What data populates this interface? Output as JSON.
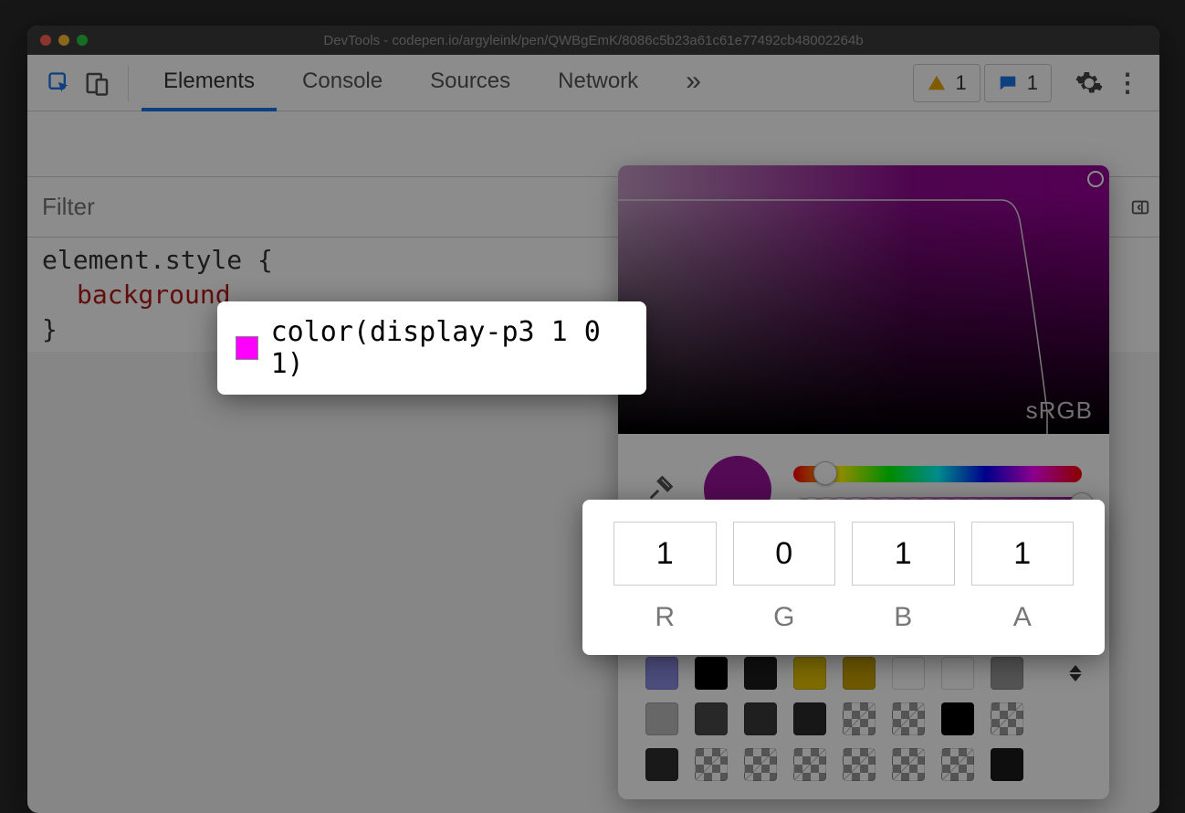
{
  "window": {
    "title": "DevTools - codepen.io/argyleink/pen/QWBgEmK/8086c5b23a61c61e77492cb48002264b"
  },
  "tabs": {
    "items": [
      "Elements",
      "Console",
      "Sources",
      "Network"
    ],
    "active": "Elements",
    "overflow_glyph": "»"
  },
  "chips": {
    "warnings": "1",
    "messages": "1"
  },
  "filter": {
    "placeholder": "Filter"
  },
  "style_rule": {
    "selector_line": "element.style {",
    "property": "background",
    "value": "color(display-p3 1 0 1)",
    "close": "}"
  },
  "picker": {
    "gamut_label": "sRGB",
    "hue_thumb_pct": 7,
    "alpha_thumb_pct": 100,
    "swatch_color": "#9b139b",
    "rgba": {
      "r": "1",
      "g": "0",
      "b": "1",
      "a": "1",
      "labels": {
        "r": "R",
        "g": "G",
        "b": "B",
        "a": "A"
      }
    },
    "palettes": [
      [
        "#8e8ee8",
        "#000000",
        "#1d1d1d",
        "#e7c700",
        "#caa500",
        "#ffffff",
        "#ffffff",
        "#9a9a9a"
      ],
      [
        "#bcbcbc",
        "#4a4a4a",
        "#3a3a3a",
        "#2a2a2a",
        "checker",
        "checker",
        "#000000",
        "checker"
      ],
      [
        "#2f2f2f",
        "checker",
        "checker",
        "checker",
        "checker",
        "checker",
        "checker",
        "#1a1a1a"
      ]
    ]
  },
  "icons": {
    "kebab": "⋮"
  }
}
